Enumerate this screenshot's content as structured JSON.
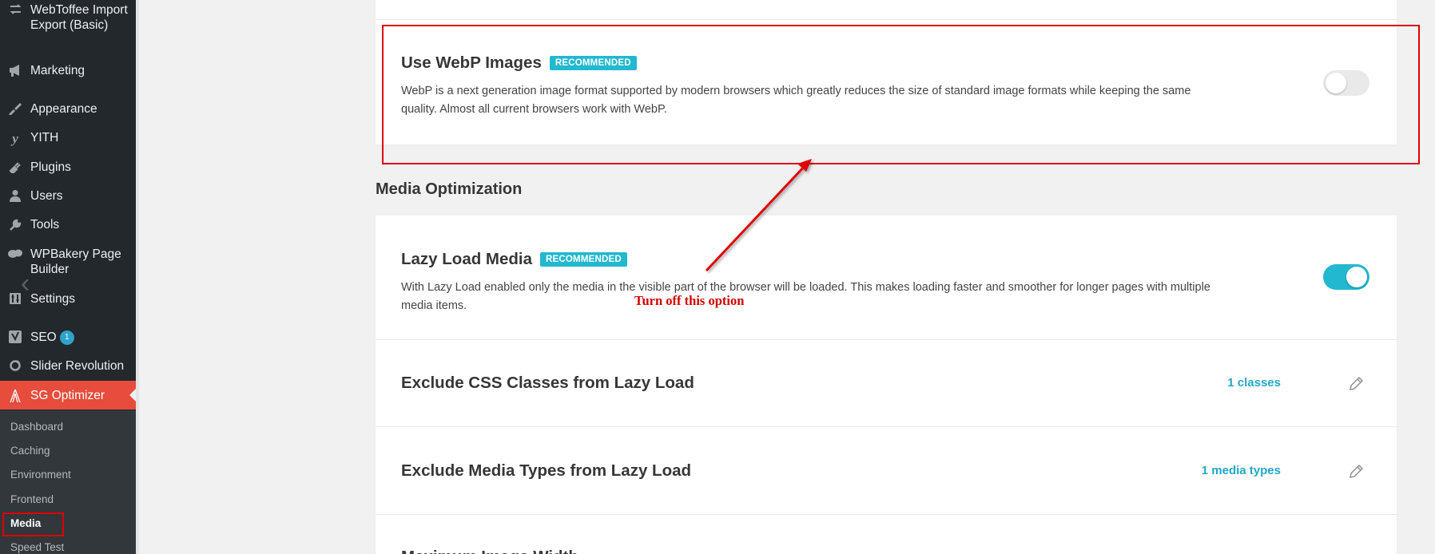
{
  "sidebar": {
    "items": [
      {
        "label": "WebToffee Import Export (Basic)",
        "icon": "import-export-icon"
      },
      {
        "label": "Marketing",
        "icon": "megaphone-icon"
      },
      {
        "label": "Appearance",
        "icon": "paintbrush-icon"
      },
      {
        "label": "YITH",
        "icon": "yith-icon"
      },
      {
        "label": "Plugins",
        "icon": "plugin-icon"
      },
      {
        "label": "Users",
        "icon": "user-icon"
      },
      {
        "label": "Tools",
        "icon": "wrench-icon"
      },
      {
        "label": "WPBakery Page Builder",
        "icon": "wpbakery-icon"
      },
      {
        "label": "Settings",
        "icon": "settings-icon"
      },
      {
        "label": "SEO",
        "icon": "yoast-icon",
        "badge": "1"
      },
      {
        "label": "Slider Revolution",
        "icon": "refresh-icon"
      },
      {
        "label": "SG Optimizer",
        "icon": "sg-optimizer-icon",
        "active": true
      }
    ],
    "submenu": [
      "Dashboard",
      "Caching",
      "Environment",
      "Frontend",
      "Media",
      "Speed Test"
    ],
    "current_submenu": "Media"
  },
  "webp": {
    "title": "Use WebP Images",
    "badge": "RECOMMENDED",
    "description_line1": "WebP is a next generation image format supported by modern browsers which greatly reduces the size of standard image formats while keeping the same",
    "description_line2": "quality. Almost all current browsers work with WebP.",
    "enabled": false
  },
  "media_optimization": {
    "section_title": "Media Optimization",
    "lazy_load": {
      "title": "Lazy Load Media",
      "badge": "RECOMMENDED",
      "description_line1": "With Lazy Load enabled only the media in the visible part of the browser will be loaded. This makes loading faster and smoother for longer pages with multiple",
      "description_line2": "media items.",
      "enabled": true
    },
    "exclude_css": {
      "title": "Exclude CSS Classes from Lazy Load",
      "value": "1 classes"
    },
    "exclude_media": {
      "title": "Exclude Media Types from Lazy Load",
      "value": "1 media types"
    },
    "partial_next": {
      "title": "Maximum Image Width"
    }
  },
  "annotation": {
    "text": "Turn off this option"
  },
  "colors": {
    "sidebar_bg": "#23282d",
    "active_menu": "#e74c3c",
    "accent": "#22b8cf",
    "annotation": "#e00000"
  }
}
